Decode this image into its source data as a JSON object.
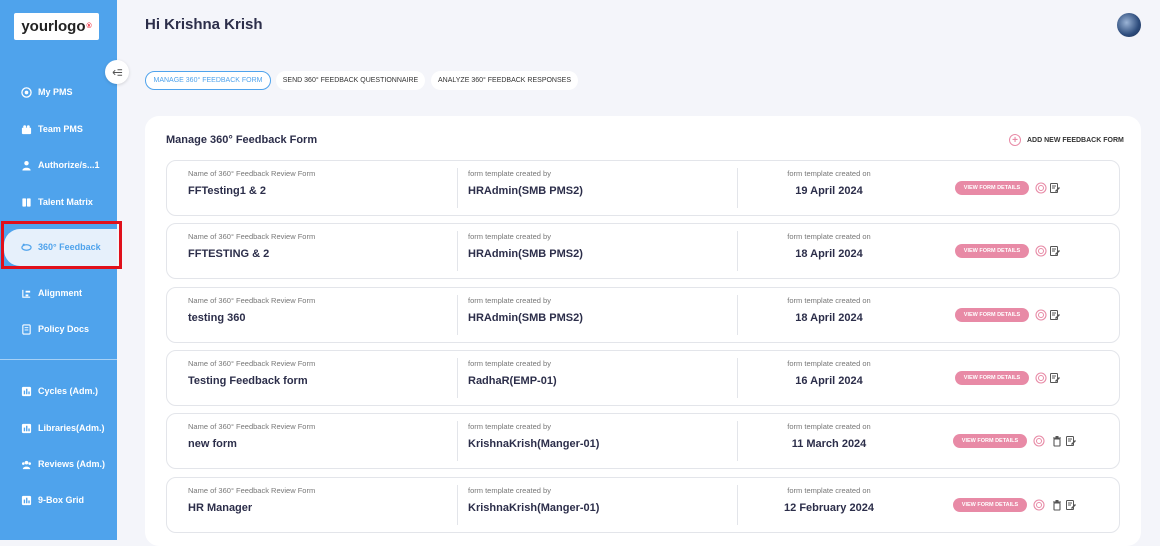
{
  "logo": {
    "text": "your",
    "text2": "logo",
    "mark": "®"
  },
  "nav": {
    "top": [
      {
        "label": "My PMS",
        "icon": "target-icon"
      },
      {
        "label": "Team PMS",
        "icon": "team-icon"
      },
      {
        "label": "Authorize/s...1",
        "icon": "person-icon"
      },
      {
        "label": "Talent Matrix",
        "icon": "book-icon"
      },
      {
        "label": "360° Feedback",
        "icon": "feedback-icon"
      },
      {
        "label": "Alignment",
        "icon": "alignment-icon"
      },
      {
        "label": "Policy Docs",
        "icon": "document-icon"
      }
    ],
    "admin": [
      {
        "label": "Cycles (Adm.)",
        "icon": "chart-icon"
      },
      {
        "label": "Libraries(Adm.)",
        "icon": "chart-icon"
      },
      {
        "label": "Reviews (Adm.)",
        "icon": "group-icon"
      },
      {
        "label": "9-Box Grid",
        "icon": "chart-icon"
      }
    ]
  },
  "header": {
    "greeting": "Hi Krishna Krish"
  },
  "tabs": [
    {
      "label": "MANAGE 360° FEEDBACK FORM",
      "active": true
    },
    {
      "label": "SEND 360° FEEDBACK QUESTIONNAIRE",
      "active": false
    },
    {
      "label": "ANALYZE 360° FEEDBACK RESPONSES",
      "active": false
    }
  ],
  "panel": {
    "title": "Manage 360° Feedback Form",
    "add_new_label": "ADD NEW FEEDBACK FORM",
    "col_name_label": "Name of 360° Feedback Review Form",
    "col_created_by_label": "form template created by",
    "col_created_on_label": "form template created on",
    "view_label": "VIEW FORM DETAILS"
  },
  "forms": [
    {
      "name": "FFTesting1 & 2",
      "created_by": "HRAdmin(SMB PMS2)",
      "created_on": "19 April 2024",
      "deletable": false
    },
    {
      "name": "FFTESTING & 2",
      "created_by": "HRAdmin(SMB PMS2)",
      "created_on": "18 April 2024",
      "deletable": false
    },
    {
      "name": "testing 360",
      "created_by": "HRAdmin(SMB PMS2)",
      "created_on": "18 April 2024",
      "deletable": false
    },
    {
      "name": "Testing Feedback form",
      "created_by": "RadhaR(EMP-01)",
      "created_on": "16 April 2024",
      "deletable": false
    },
    {
      "name": "new form",
      "created_by": "KrishnaKrish(Manger-01)",
      "created_on": "11 March 2024",
      "deletable": true
    },
    {
      "name": "HR Manager",
      "created_by": "KrishnaKrish(Manger-01)",
      "created_on": "12 February 2024",
      "deletable": true
    }
  ],
  "colors": {
    "sidebar": "#4fa3ec",
    "accent_pink": "#e88aa6",
    "highlight": "#e0101b"
  }
}
